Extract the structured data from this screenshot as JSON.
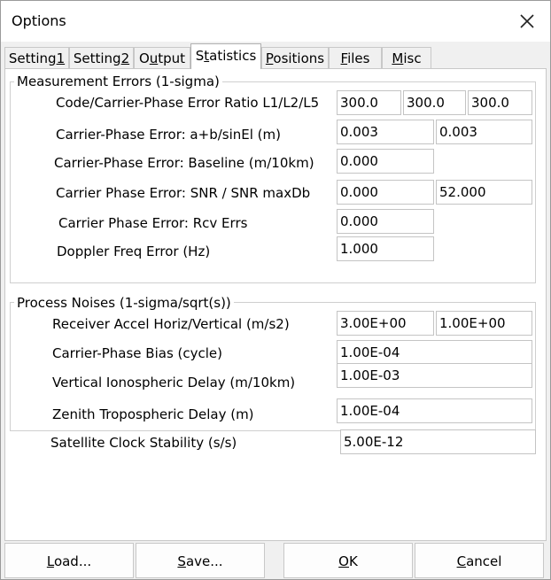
{
  "window": {
    "title": "Options"
  },
  "tabs": [
    {
      "pre": "Setting",
      "acc": "1",
      "post": ""
    },
    {
      "pre": "Setting",
      "acc": "2",
      "post": ""
    },
    {
      "pre": "O",
      "acc": "u",
      "post": "tput"
    },
    {
      "pre": "S",
      "acc": "t",
      "post": "atistics"
    },
    {
      "pre": "",
      "acc": "P",
      "post": "ositions"
    },
    {
      "pre": "",
      "acc": "F",
      "post": "iles"
    },
    {
      "pre": "",
      "acc": "M",
      "post": "isc"
    }
  ],
  "measurement": {
    "title": "Measurement Errors (1-sigma)",
    "ratio_label": "Code/Carrier-Phase Error Ratio L1/L2/L5",
    "ratio_l1": "300.0",
    "ratio_l2": "300.0",
    "ratio_l5": "300.0",
    "ab_label": "Carrier-Phase Error: a+b/sinEl (m)",
    "ab_a": "0.003",
    "ab_b": "0.003",
    "baseline_label": "Carrier-Phase Error: Baseline (m/10km)",
    "baseline": "0.000",
    "snr_label": "Carrier Phase Error: SNR / SNR maxDb",
    "snr": "0.000",
    "snr_max": "52.000",
    "rcv_label": "Carrier Phase Error: Rcv Errs",
    "rcv": "0.000",
    "doppler_label": "Doppler Freq Error (Hz)",
    "doppler": "1.000"
  },
  "noises": {
    "title": "Process Noises (1-sigma/sqrt(s))",
    "accel_label": "Receiver Accel Horiz/Vertical (m/s2)",
    "accel_h": "3.00E+00",
    "accel_v": "1.00E+00",
    "bias_label": "Carrier-Phase Bias (cycle)",
    "bias": "1.00E-04",
    "iono_label": "Vertical Ionospheric Delay (m/10km)",
    "iono": "1.00E-03",
    "tropo_label": "Zenith Tropospheric Delay (m)",
    "tropo": "1.00E-04",
    "clock_label": "Satellite Clock Stability (s/s)",
    "clock": "5.00E-12"
  },
  "buttons": {
    "load": {
      "pre": "",
      "acc": "L",
      "post": "oad..."
    },
    "save": {
      "pre": "",
      "acc": "S",
      "post": "ave..."
    },
    "ok": {
      "pre": "",
      "acc": "O",
      "post": "K"
    },
    "cancel": {
      "pre": "",
      "acc": "C",
      "post": "ancel"
    }
  }
}
